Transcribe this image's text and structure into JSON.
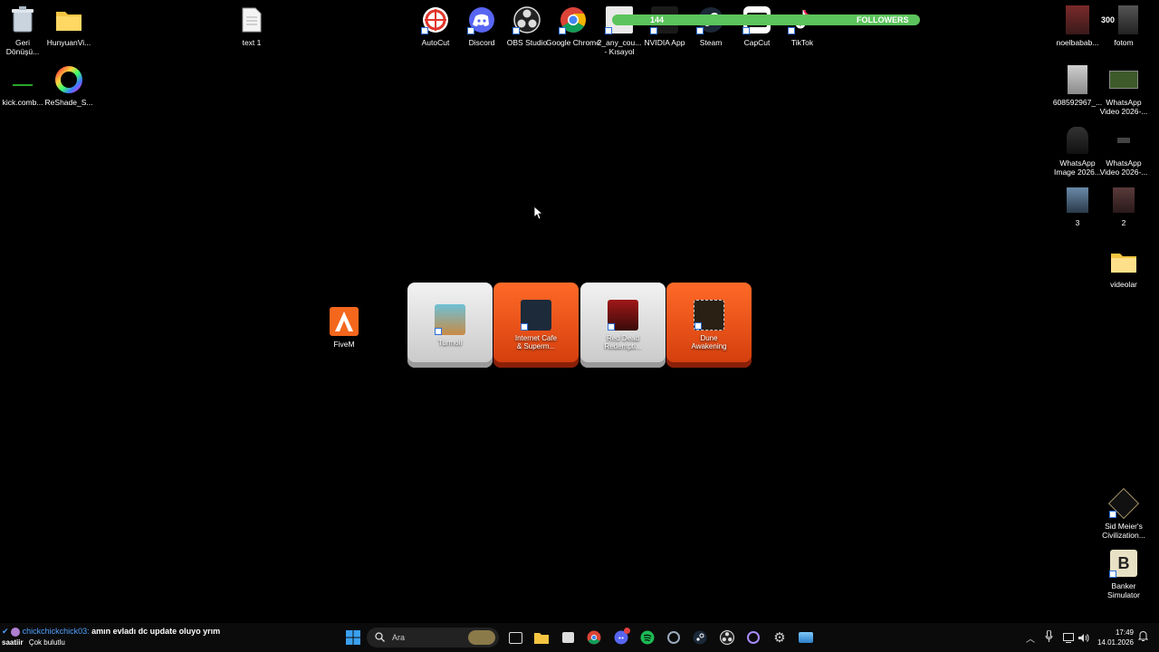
{
  "desktop": {
    "left_icons": [
      {
        "label": "Geri\nDönüşü...",
        "icon": "recycle-bin-icon"
      },
      {
        "label": "HunyuanVi...",
        "icon": "folder-icon"
      },
      {
        "label": "kick.comb...",
        "icon": "file-icon"
      },
      {
        "label": "ReShade_S...",
        "icon": "reshade-icon"
      }
    ],
    "text_file": {
      "label": "text 1",
      "icon": "text-file-icon"
    },
    "top_apps": [
      {
        "label": "AutoCut",
        "icon": "autocut-icon"
      },
      {
        "label": "Discord",
        "icon": "discord-icon"
      },
      {
        "label": "OBS Studio",
        "icon": "obs-icon"
      },
      {
        "label": "Google Chrome",
        "icon": "chrome-icon"
      },
      {
        "label": "2_any_cou...\n- Kısayol",
        "icon": "shortcut-icon"
      },
      {
        "label": "NVIDIA App",
        "icon": "nvidia-icon"
      },
      {
        "label": "Steam",
        "icon": "steam-icon"
      },
      {
        "label": "CapCut",
        "icon": "capcut-icon"
      },
      {
        "label": "TikTok",
        "icon": "tiktok-icon"
      }
    ],
    "right_icons": [
      {
        "label": "noelbabab...",
        "icon": "image-icon"
      },
      {
        "label": "fotom",
        "icon": "image-icon"
      },
      {
        "label": "608592967_...",
        "icon": "image-icon"
      },
      {
        "label": "WhatsApp\nVideo 2026-...",
        "icon": "video-icon"
      },
      {
        "label": "WhatsApp\nImage 2026...",
        "icon": "image-icon"
      },
      {
        "label": "WhatsApp\nVideo 2026-...",
        "icon": "video-icon"
      },
      {
        "label": "3",
        "icon": "image-icon"
      },
      {
        "label": "2",
        "icon": "image-icon"
      },
      {
        "label": "videolar",
        "icon": "folder-icon"
      },
      {
        "label": "Sid Meier's\nCivilization...",
        "icon": "civilization-icon"
      },
      {
        "label": "Banker\nSimulator",
        "icon": "banker-icon"
      }
    ],
    "fivem": {
      "label": "FiveM",
      "icon": "fivem-icon"
    },
    "games": [
      {
        "label": "Turmoil",
        "style": "white",
        "icon": "turmoil-icon"
      },
      {
        "label": "Internet Cafe\n& Superm...",
        "style": "orange",
        "icon": "internet-cafe-icon"
      },
      {
        "label": "Red Dead\nRedempti...",
        "style": "white",
        "icon": "red-dead-icon"
      },
      {
        "label": "Dune\nAwakening",
        "style": "orange",
        "icon": "dune-icon"
      }
    ]
  },
  "overlay": {
    "followers_count": "144",
    "followers_label": "FOLLOWERS",
    "followers_goal": "300",
    "chat_user": "chickchickchick03:",
    "chat_message": "amın evladı dc update oluyo yrım",
    "chat_sub_bold": "saatiir",
    "chat_sub": "Çok bulutlu"
  },
  "taskbar": {
    "search_placeholder": "Ara",
    "time": "17:49",
    "date": "14.01.2026"
  },
  "colors": {
    "followers_bar": "#5cc45c",
    "tile_orange": "#e84d16",
    "taskbar": "#0b0b0b"
  }
}
